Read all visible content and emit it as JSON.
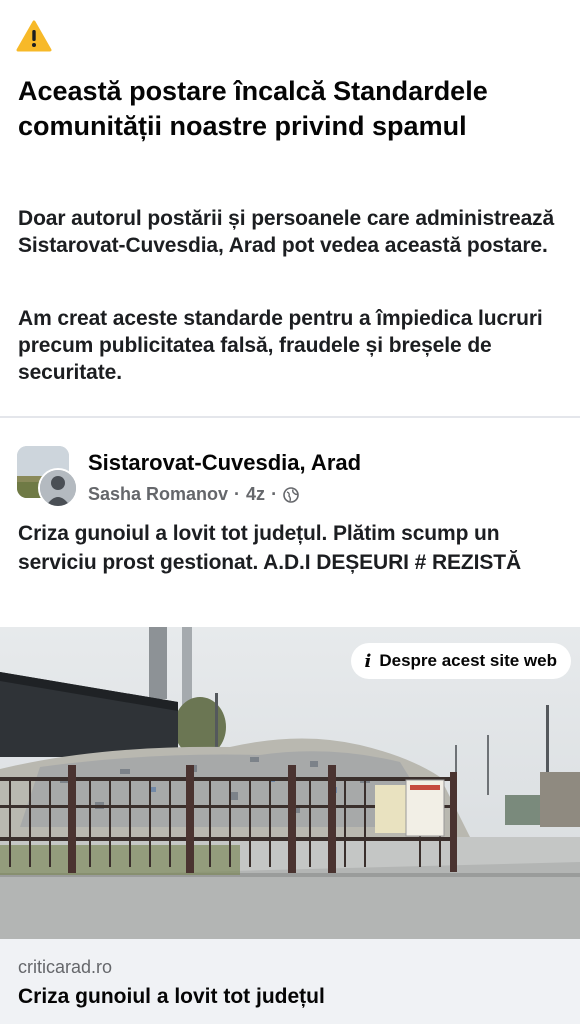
{
  "warning": {
    "icon": "warning-triangle-icon",
    "icon_color": "#f7b928",
    "title": "Această postare încalcă Standardele comunității noastre privind spamul",
    "paragraph1": "Doar autorul postării și persoanele care administrează Sistarovat-Cuvesdia, Arad pot vedea această postare.",
    "paragraph2": "Am creat aceste standarde pentru a împiedica lucruri precum publicitatea falsă, fraudele și breșele de securitate."
  },
  "post": {
    "group_name": "Sistarovat-Cuvesdia, Arad",
    "author": "Sasha Romanov",
    "separator": "·",
    "time": "4z",
    "audience_icon": "globe-icon",
    "text": "Criza gunoiul a lovit tot județul. Plătim scump un serviciu prost gestionat. A.D.I DEȘEURI # REZISTĂ"
  },
  "link_preview": {
    "about_site_label": "Despre acest site web",
    "info_icon": "info-icon",
    "domain": "criticarad.ro",
    "title": "Criza gunoiul a lovit tot județul"
  }
}
